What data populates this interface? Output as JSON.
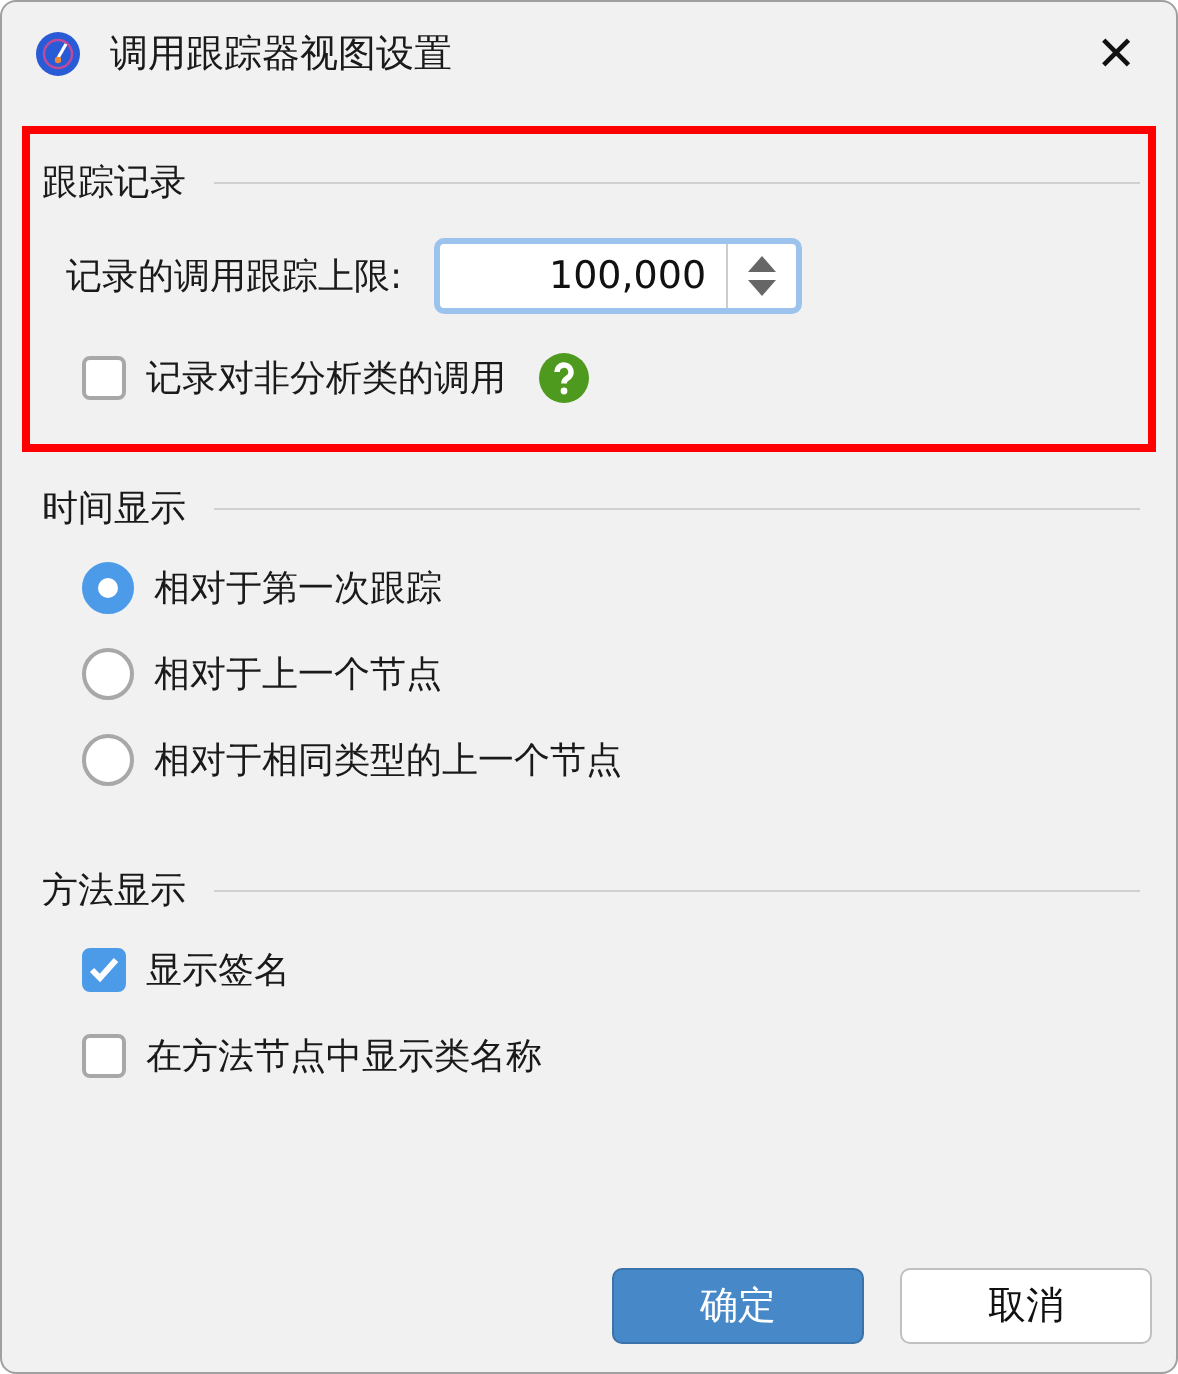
{
  "window": {
    "title": "调用跟踪器视图设置",
    "close": "✕"
  },
  "sections": [
    {
      "title": "跟踪记录",
      "highlighted": true,
      "items": [
        {
          "kind": "spinner",
          "label": "记录的调用跟踪上限:",
          "value": "100,000"
        },
        {
          "kind": "checkbox",
          "label": "记录对非分析类的调用",
          "checked": false,
          "help": true
        }
      ]
    },
    {
      "title": "时间显示",
      "highlighted": false,
      "items": [
        {
          "kind": "radio",
          "label": "相对于第一次跟踪",
          "selected": true
        },
        {
          "kind": "radio",
          "label": "相对于上一个节点",
          "selected": false
        },
        {
          "kind": "radio",
          "label": "相对于相同类型的上一个节点",
          "selected": false
        }
      ]
    },
    {
      "title": "方法显示",
      "highlighted": false,
      "items": [
        {
          "kind": "checkbox",
          "label": "显示签名",
          "checked": true
        },
        {
          "kind": "checkbox",
          "label": "在方法节点中显示类名称",
          "checked": false
        }
      ]
    }
  ],
  "buttons": [
    {
      "label": "确定",
      "primary": true
    },
    {
      "label": "取消",
      "primary": false
    }
  ]
}
